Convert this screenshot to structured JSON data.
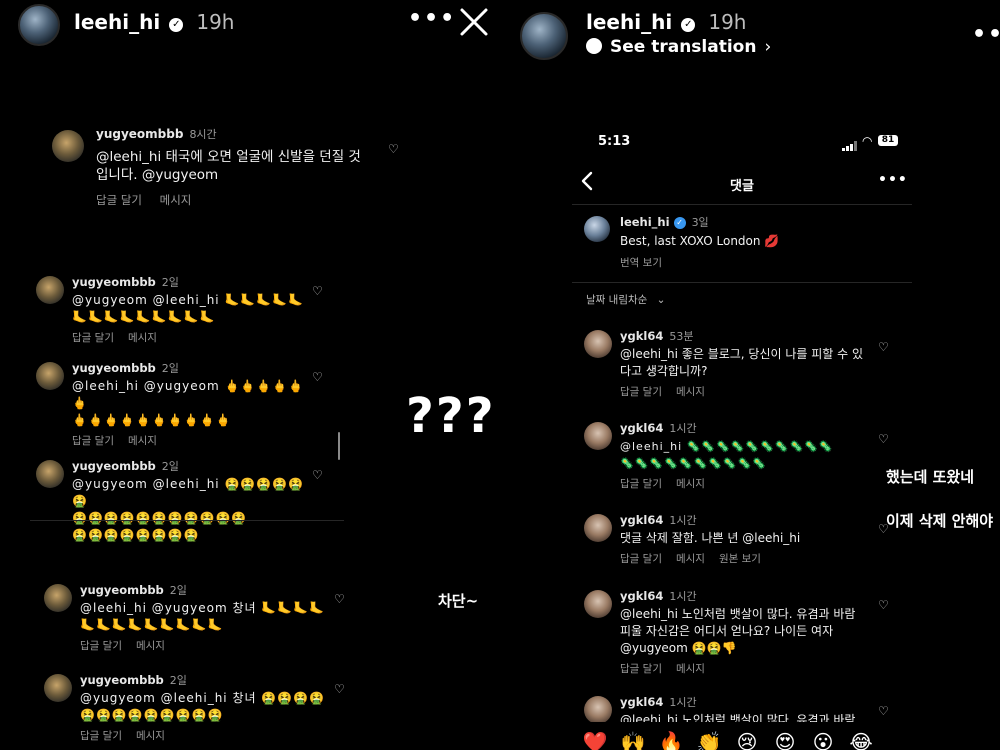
{
  "left_story": {
    "username": "leehi_hi",
    "time": "19h",
    "featured_comment": {
      "user": "yugyeombbb",
      "time": "8시간",
      "text_line1": "@leehi_hi 태국에 오면 얼굴에 신발을 던질 것",
      "text_line2": "입니다. @yugyeom",
      "reply": "답글 달기",
      "message": "메시지"
    },
    "comments": [
      {
        "user": "yugyeombbb",
        "time": "2일",
        "text_line1": "@yugyeom @leehi_hi 🦶🦶🦶🦶🦶",
        "text_line2": "🦶🦶🦶🦶🦶🦶🦶🦶🦶",
        "reply": "답글 달기",
        "message": "메시지"
      },
      {
        "user": "yugyeombbb",
        "time": "2일",
        "text_line1": "@leehi_hi @yugyeom 🖕🖕🖕🖕🖕🖕",
        "text_line2": "🖕🖕🖕🖕🖕🖕🖕🖕🖕🖕",
        "reply": "답글 달기",
        "message": "메시지"
      },
      {
        "user": "yugyeombbb",
        "time": "2일",
        "text_line1": "@yugyeom @leehi_hi 🤮🤮🤮🤮🤮🤮",
        "text_line2": "🤮🤮🤮🤮🤮🤮🤮🤮🤮🤮🤮",
        "text_line3": "🤮🤮🤮🤮🤮🤮🤮🤮",
        "reply": "답글 달기",
        "message": "메시지"
      },
      {
        "user": "yugyeombbb",
        "time": "2일",
        "text_line1": "@leehi_hi @yugyeom 창녀 🦶🦶🦶🦶",
        "text_line2": "🦶🦶🦶🦶🦶🦶🦶🦶🦶",
        "reply": "답글 달기",
        "message": "메시지"
      },
      {
        "user": "yugyeombbb",
        "time": "2일",
        "text_line1": "@yugyeom @leehi_hi 창녀 🤮🤮🤮🤮",
        "text_line2": "🤮🤮🤮🤮🤮🤮🤮🤮🤮",
        "reply": "답글 달기",
        "message": "메시지"
      }
    ]
  },
  "overlays": {
    "question": "???",
    "blocked": "차단~",
    "came_back": "했는데 또왔네",
    "not_deleting": "이제 삭제 안해야"
  },
  "right_story": {
    "username": "leehi_hi",
    "time": "19h",
    "see_translation": "See translation",
    "phone": {
      "clock": "5:13",
      "battery": "81",
      "header_title": "댓글",
      "post": {
        "user": "leehi_hi",
        "time": "3일",
        "text": "Best, last  XOXO London 💋",
        "see_translation": "번역 보기"
      },
      "sort_label": "날짜 내림차순",
      "comments": [
        {
          "user": "ygkl64",
          "time": "53분",
          "text_line1": "@leehi_hi 좋은 블로그, 당신이 나를 피할 수 있",
          "text_line2": "다고 생각합니까?",
          "reply": "답글 달기",
          "message": "메시지"
        },
        {
          "user": "ygkl64",
          "time": "1시간",
          "text_line1": "@leehi_hi 🦠🦠🦠🦠🦠🦠🦠🦠🦠🦠",
          "text_line2": "🦠🦠🦠🦠🦠🦠🦠🦠🦠🦠",
          "reply": "답글 달기",
          "message": "메시지"
        },
        {
          "user": "ygkl64",
          "time": "1시간",
          "text_line1": "댓글 삭제 잘함. 나쁜 년 @leehi_hi",
          "reply": "답글 달기",
          "message": "메시지",
          "original": "원본 보기"
        },
        {
          "user": "ygkl64",
          "time": "1시간",
          "text_line1": "@leehi_hi 노인처럼 뱃살이 많다.  유겸과 바람",
          "text_line2": "피울 자신감은 어디서 얻나요?  나이든 여자",
          "text_line3": "@yugyeom 🤮🤮👎",
          "reply": "답글 달기",
          "message": "메시지"
        },
        {
          "user": "ygkl64",
          "time": "1시간",
          "text_line1": "@leehi_hi 노인처럼 뱃살이 많다.  유겸과 바람"
        }
      ],
      "reactions": [
        "❤️",
        "🙌",
        "🔥",
        "👏",
        "😢",
        "😍",
        "😮",
        "😂"
      ]
    }
  }
}
